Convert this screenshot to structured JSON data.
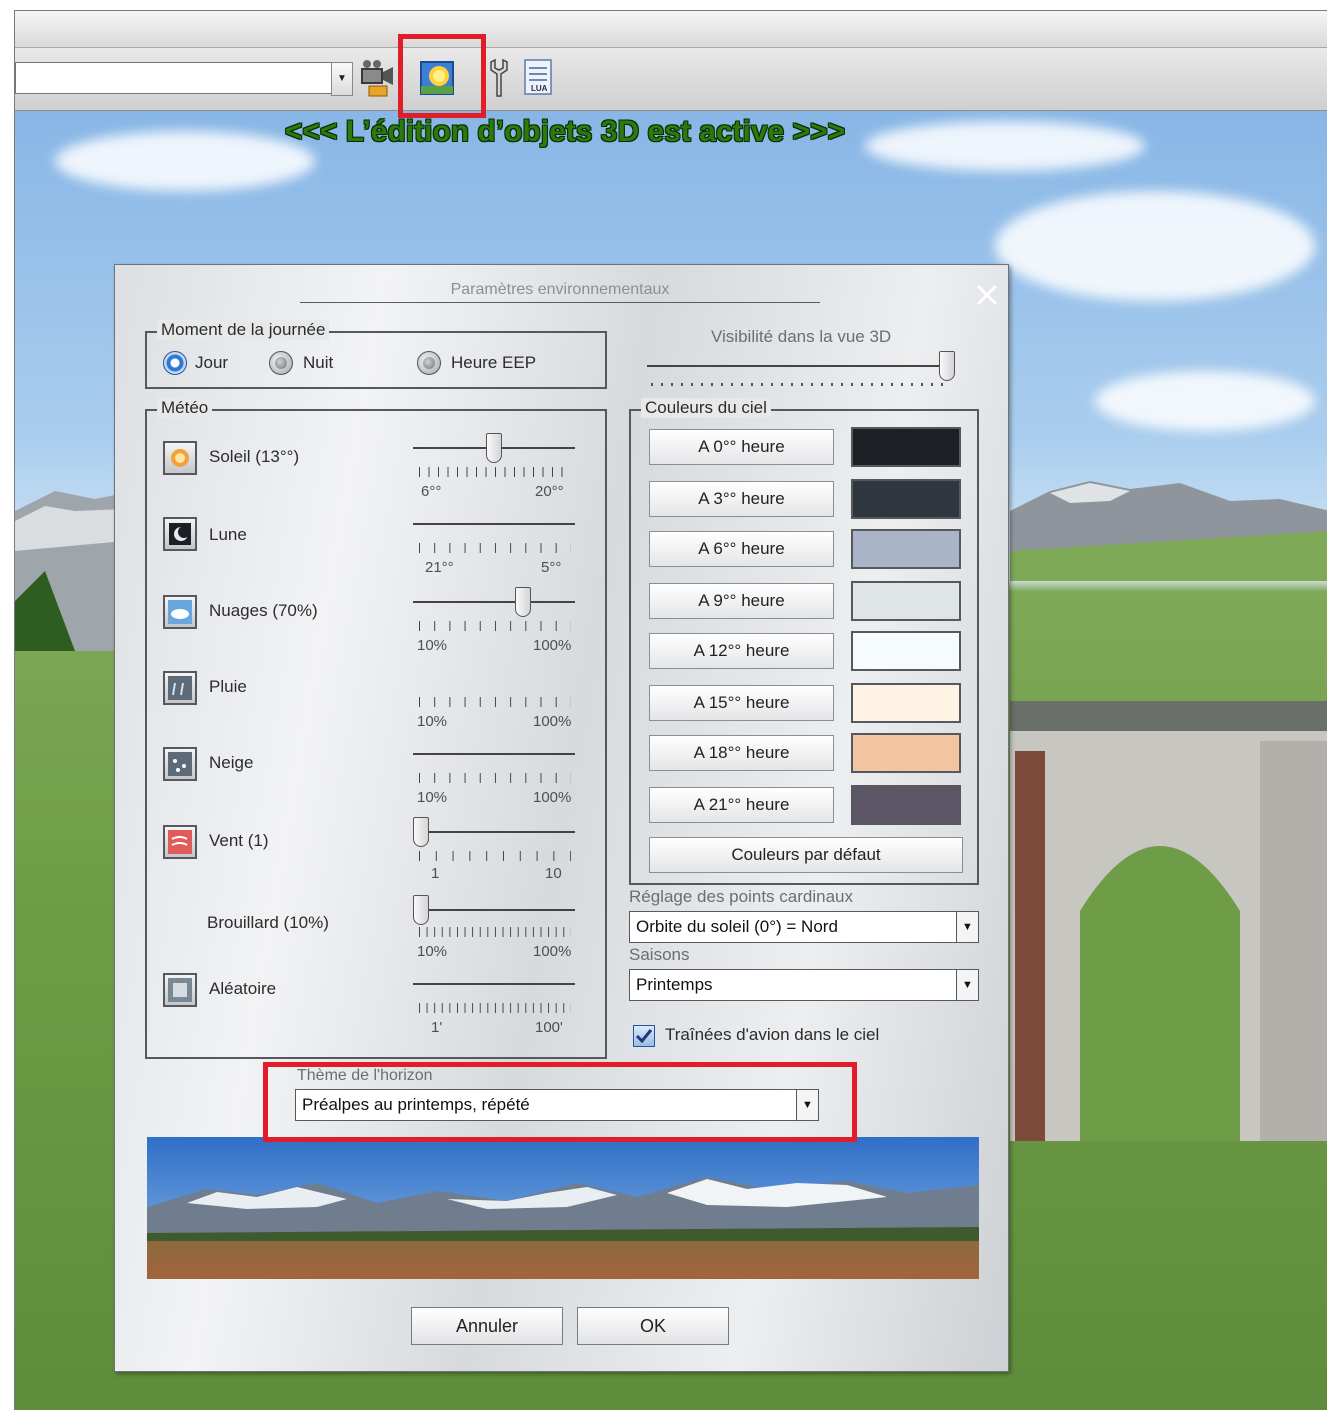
{
  "banner": "<<<  L’édition d’objets 3D est active  >>>",
  "toolbar": {
    "icons": [
      "film-camera-icon",
      "environment-sun-icon",
      "wrench-icon",
      "lua-script-icon"
    ],
    "lua_label": "LUA"
  },
  "dialog": {
    "title": "Paramètres environnementaux",
    "time_of_day": {
      "legend": "Moment de la journée",
      "options": [
        "Jour",
        "Nuit",
        "Heure EEP"
      ],
      "selected": "Jour"
    },
    "visibility": {
      "label": "Visibilité dans la vue 3D",
      "level": 1.0
    },
    "weather": {
      "legend": "Météo",
      "items": [
        {
          "label": "Soleil (13°°)",
          "icon": "sun-icon",
          "min": "6°°",
          "max": "20°°",
          "value": 0.5
        },
        {
          "label": "Lune",
          "icon": "moon-icon",
          "min": "21°°",
          "max": "5°°"
        },
        {
          "label": "Nuages (70%)",
          "icon": "clouds-icon",
          "min": "10%",
          "max": "100%",
          "value": 0.7
        },
        {
          "label": "Pluie",
          "icon": "rain-icon",
          "min": "10%",
          "max": "100%"
        },
        {
          "label": "Neige",
          "icon": "snow-icon",
          "min": "10%",
          "max": "100%"
        },
        {
          "label": "Vent (1)",
          "icon": "wind-icon",
          "min": "1",
          "max": "10",
          "value": 0.0
        },
        {
          "label": "Brouillard (10%)",
          "icon": "",
          "min": "10%",
          "max": "100%",
          "value": 0.0
        },
        {
          "label": "Aléatoire",
          "icon": "random-icon",
          "min": "1'",
          "max": "100'"
        }
      ]
    },
    "sky_colors": {
      "legend": "Couleurs du ciel",
      "entries": [
        {
          "label": "A 0°° heure",
          "color": "#1d2024"
        },
        {
          "label": "A 3°° heure",
          "color": "#2f363d"
        },
        {
          "label": "A 6°° heure",
          "color": "#a9b4c8"
        },
        {
          "label": "A 9°° heure",
          "color": "#dfe5e6"
        },
        {
          "label": "A 12°° heure",
          "color": "#f6fbfe"
        },
        {
          "label": "A 15°° heure",
          "color": "#fff3e3"
        },
        {
          "label": "A 18°° heure",
          "color": "#f2c49f"
        },
        {
          "label": "A 21°° heure",
          "color": "#5c5566"
        }
      ],
      "default_button": "Couleurs par défaut"
    },
    "cardinal": {
      "label": "Réglage des points cardinaux",
      "value": "Orbite du soleil (0°) = Nord"
    },
    "seasons": {
      "label": "Saisons",
      "value": "Printemps"
    },
    "contrails": {
      "label": "Traînées d'avion dans le ciel",
      "checked": true
    },
    "horizon": {
      "label": "Thème de l'horizon",
      "value": "Préalpes au printemps, répété"
    },
    "buttons": {
      "cancel": "Annuler",
      "ok": "OK"
    }
  },
  "colors": {
    "highlight": "#e21d2a",
    "banner_green": "#2a7a0d"
  }
}
